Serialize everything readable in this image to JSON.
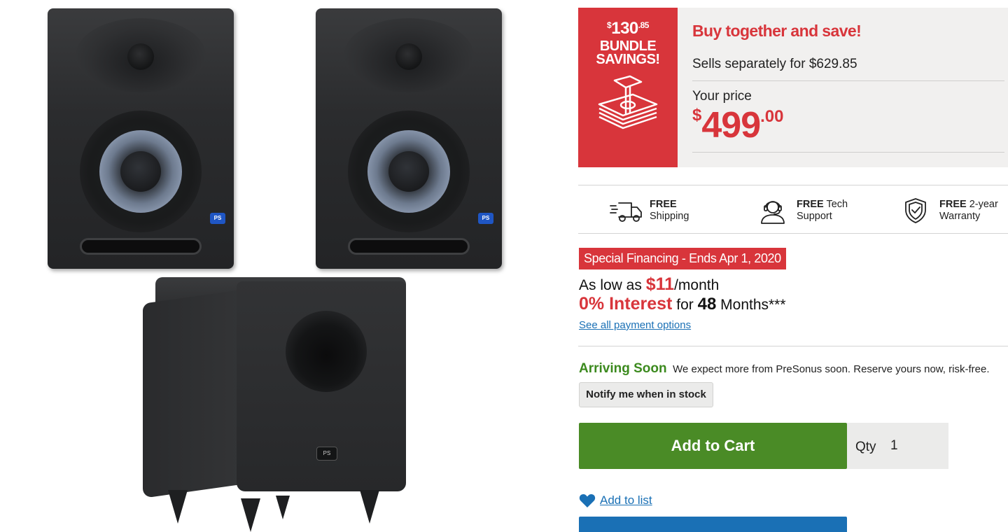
{
  "gallery": {
    "speaker_badge": "PS",
    "sub_badge": "PS"
  },
  "bundle": {
    "savings_currency": "$",
    "savings_whole": "130",
    "savings_cents": ".85",
    "savings_label": "BUNDLE SAVINGS!",
    "headline": "Buy together and save!",
    "sells_separately": "Sells separately for $629.85",
    "your_price_label": "Your price",
    "price_currency": "$",
    "price_whole": "499",
    "price_cents": ".00",
    "money_icon": "money-stack-icon"
  },
  "benefits": [
    {
      "bold": "FREE",
      "rest": "Shipping",
      "icon": "truck-icon"
    },
    {
      "bold": "FREE",
      "rest": "Tech Support",
      "rest1": "Tech",
      "rest2": "Support",
      "icon": "headset-agent-icon"
    },
    {
      "bold": "FREE",
      "rest": "2-year Warranty",
      "rest1": "2-year",
      "rest2": "Warranty",
      "icon": "shield-check-icon"
    }
  ],
  "financing": {
    "tag": "Special Financing - Ends Apr 1, 2020",
    "as_low_prefix": "As low as",
    "monthly_amount": "$11",
    "monthly_suffix": "/month",
    "interest_rate": "0% Interest",
    "interest_for": "for",
    "months_count": "48",
    "months_suffix": "Months***",
    "payment_link": "See all payment options"
  },
  "availability": {
    "status": "Arriving Soon",
    "message": "We expect more from PreSonus soon. Reserve yours now, risk-free.",
    "notify_button": "Notify me when in stock"
  },
  "cart": {
    "add_to_cart": "Add to Cart",
    "qty_label": "Qty",
    "qty_value": "1",
    "add_to_list": "Add to list"
  },
  "colors": {
    "accent_red": "#d8353b",
    "cart_green": "#4a8b26",
    "link_blue": "#1a70b5",
    "arriving_green": "#3c8a1e"
  }
}
